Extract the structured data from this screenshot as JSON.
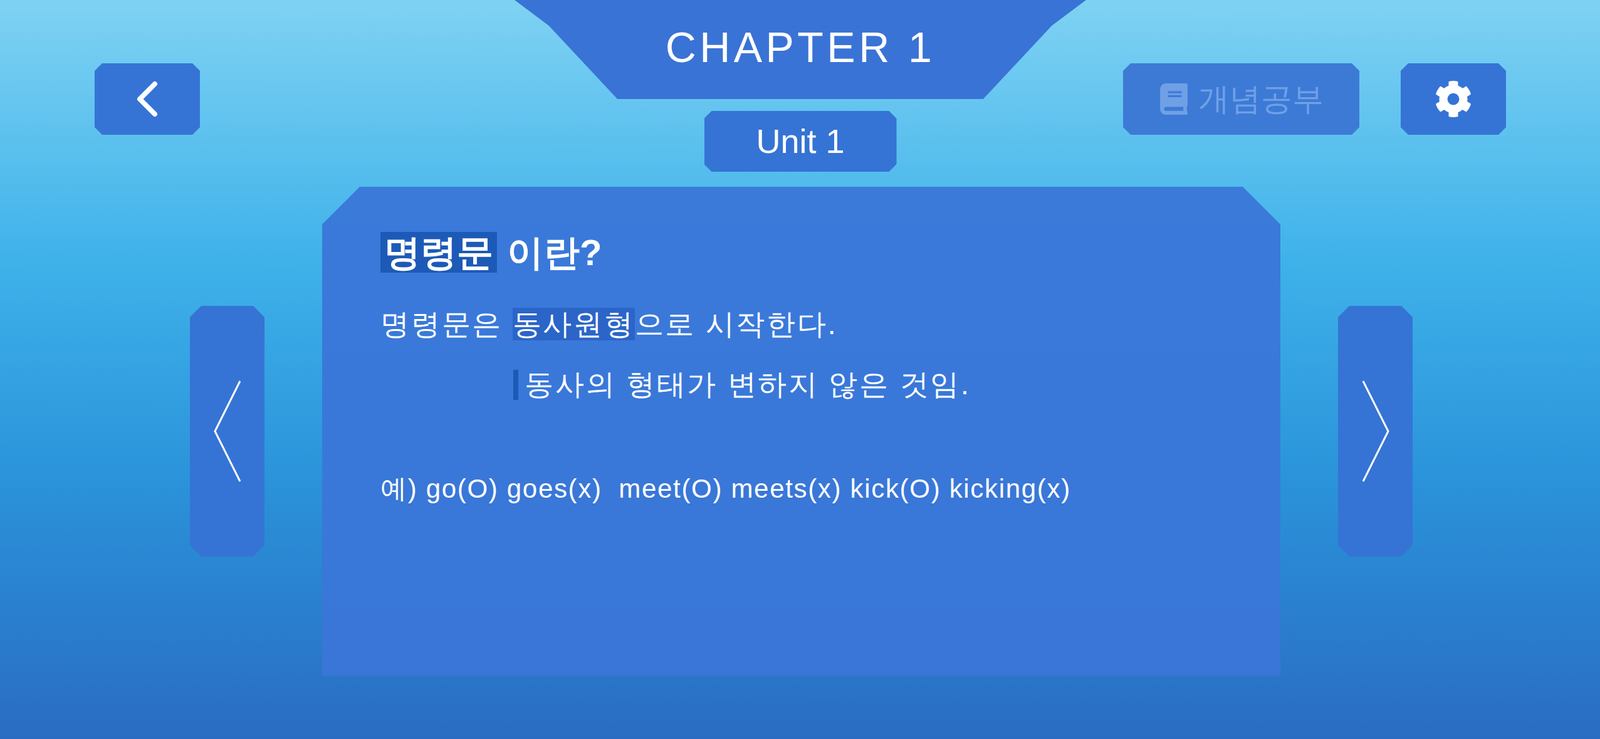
{
  "header": {
    "chapter": "CHAPTER 1",
    "unit": "Unit 1"
  },
  "concept_button": {
    "label": "개념공부",
    "disabled": true
  },
  "lesson": {
    "title": [
      {
        "text": "명령문",
        "highlighted": true
      },
      {
        "text": " 이란?",
        "highlighted": false
      }
    ],
    "rule": [
      {
        "text": "명령문은 ",
        "highlighted": false
      },
      {
        "text": "동사원형",
        "highlighted": true
      },
      {
        "text": "으로 시작한다.",
        "highlighted": false
      }
    ],
    "note": "동사의 형태가 변하지 않은 것임.",
    "example": "예) go(O) goes(x)  meet(O) meets(x) kick(O) kicking(x)"
  }
}
